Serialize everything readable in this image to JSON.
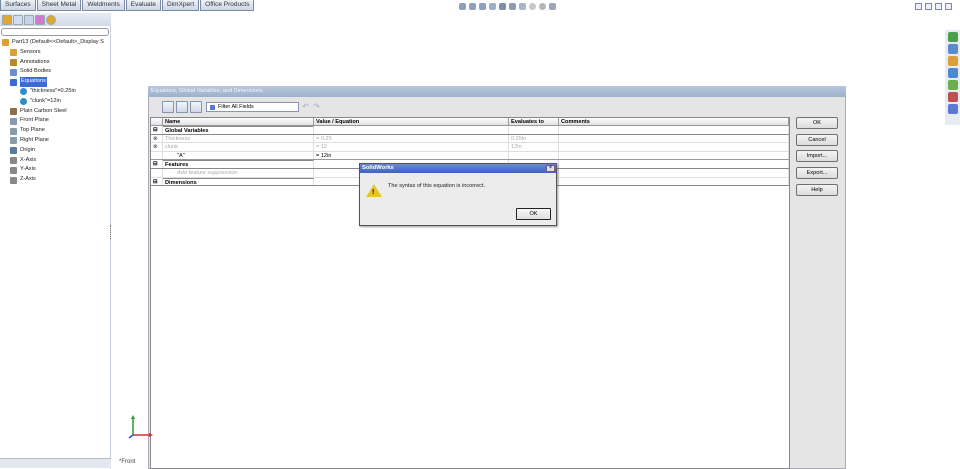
{
  "tabs": [
    "Surfaces",
    "Sheet Metal",
    "Weldments",
    "Evaluate",
    "DimXpert",
    "Office Products"
  ],
  "tree": {
    "part": "Part13  (Default<<Default>_Display S",
    "items": [
      {
        "label": "Sensors",
        "color": "#d9a03a"
      },
      {
        "label": "Annotations",
        "color": "#b88a28"
      },
      {
        "label": "Solid Bodies",
        "color": "#6b8fd1"
      },
      {
        "label": "Equations",
        "color": "#3a6bd3",
        "selected": true
      },
      {
        "label": "\"thickness\"=0.25in",
        "color": "#2a8fc7",
        "sub": true
      },
      {
        "label": "\"clunk\"=12in",
        "color": "#2a8fc7",
        "sub": true
      },
      {
        "label": "Plain Carbon Steel",
        "color": "#8a6f4a"
      },
      {
        "label": "Front Plane",
        "color": "#8a9aad"
      },
      {
        "label": "Top Plane",
        "color": "#8a9aad"
      },
      {
        "label": "Right Plane",
        "color": "#8a9aad"
      },
      {
        "label": "Origin",
        "color": "#5a7a9a"
      },
      {
        "label": "X-Axis",
        "color": "#888"
      },
      {
        "label": "Y-Axis",
        "color": "#888"
      },
      {
        "label": "Z-Axis",
        "color": "#888"
      }
    ]
  },
  "dialog": {
    "title": "Equations, Global Variables, and Dimensions",
    "filter": "Filter All Fields",
    "headers": {
      "name": "Name",
      "value": "Value / Equation",
      "evaluates": "Evaluates to",
      "comments": "Comments"
    },
    "global_section": "Global Variables",
    "rows": [
      {
        "name": "Thickness",
        "value": "= 0.25",
        "eval": "0.25in"
      },
      {
        "name": "clunk",
        "value": "= 12",
        "eval": "12in"
      },
      {
        "name": "\"A\"",
        "value": "= 12in",
        "eval": ""
      }
    ],
    "features_section": "Features",
    "add_feature": "Add feature suppression",
    "dimensions_section": "Dimensions",
    "buttons": [
      "OK",
      "Cancel",
      "Import...",
      "Export...",
      "Help"
    ]
  },
  "message": {
    "title": "SolidWorks",
    "text": "The syntax of this equation is incorrect.",
    "ok": "OK"
  },
  "view_label": "*Front"
}
